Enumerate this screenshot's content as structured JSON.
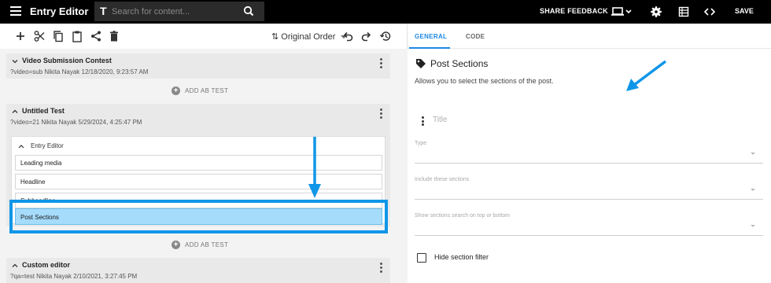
{
  "app": {
    "title": "Entry Editor"
  },
  "search": {
    "placeholder": "Search for content...",
    "prefix_icon": "T"
  },
  "topbar": {
    "share_feedback": "SHARE FEEDBACK",
    "save": "SAVE"
  },
  "toolbar": {
    "sort_label": "Original Order"
  },
  "entries": [
    {
      "title": "Video Submission Contest",
      "meta": "?video=sub Nikita Nayak 12/18/2020, 9:23:57 AM",
      "expanded": false
    },
    {
      "title": "Untitled Test",
      "meta": "?video=21 Nikita Nayak 5/29/2024, 4:25:47 PM",
      "expanded": true,
      "sub_editor": {
        "title": "Entry Editor",
        "fields": [
          "Leading media",
          "Headline",
          "Subheadline",
          "Post Sections"
        ],
        "selected": "Post Sections"
      }
    },
    {
      "title": "Custom editor",
      "meta": "?qa=test Nikita Nayak 2/10/2021, 3:27:45 PM",
      "expanded": false
    }
  ],
  "ab_test_label": "ADD AB TEST",
  "right": {
    "tabs": [
      "GENERAL",
      "CODE"
    ],
    "active_tab": "GENERAL",
    "section_title": "Post Sections",
    "section_desc": "Allows you to select the sections of the post.",
    "title_placeholder": "Title",
    "select_labels": [
      "Type",
      "Include these sections",
      "Show sections search on top or bottom"
    ],
    "checkbox_label": "Hide section filter",
    "checkbox_checked": false
  },
  "colors": {
    "accent": "#1e88e5",
    "highlight_border": "#0f96e8",
    "highlight_fill": "#a6dcfb",
    "topbar": "#000000"
  }
}
